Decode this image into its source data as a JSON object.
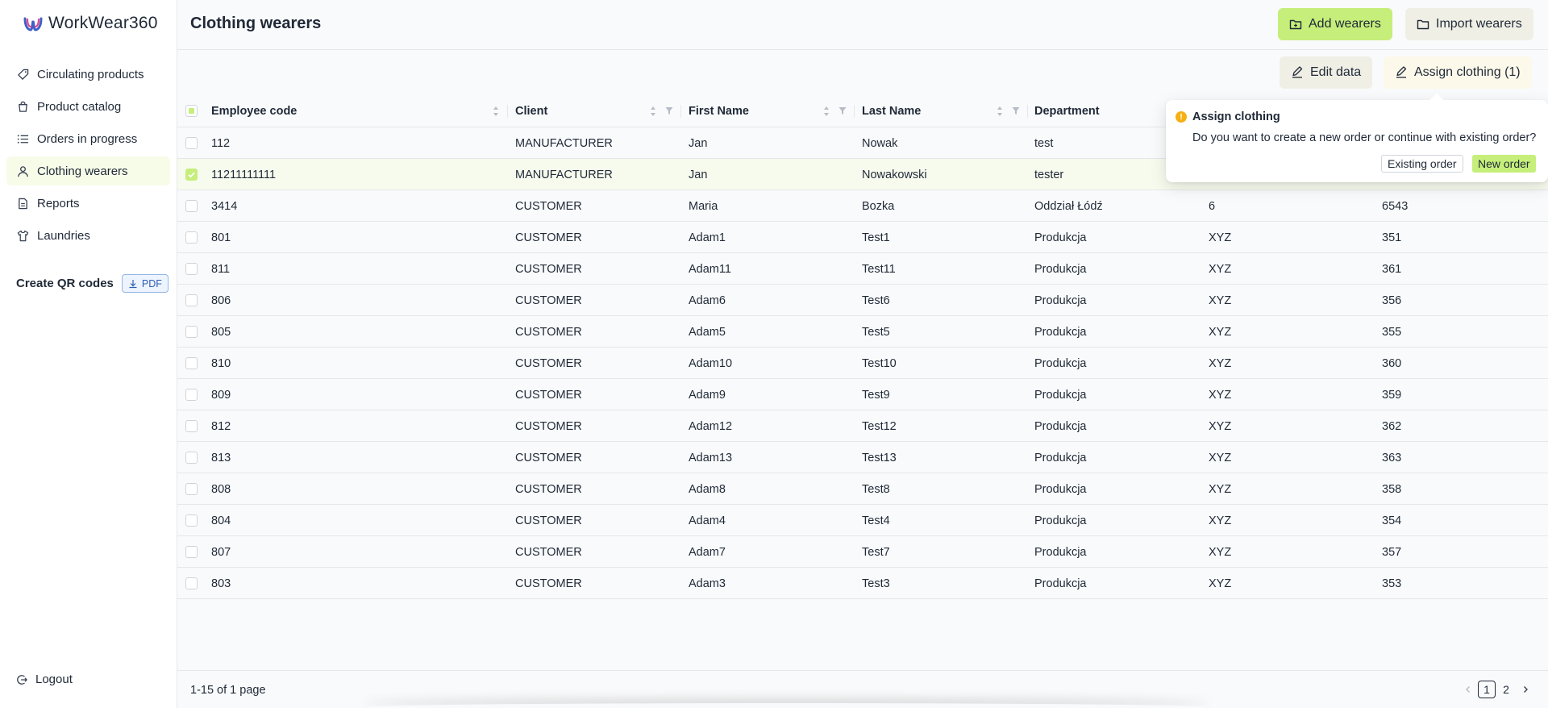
{
  "app": {
    "name": "WorkWear360"
  },
  "sidebar": {
    "items": [
      {
        "label": "Circulating products",
        "icon": "tag-icon"
      },
      {
        "label": "Product catalog",
        "icon": "shopping-bag-icon"
      },
      {
        "label": "Orders in progress",
        "icon": "list-icon"
      },
      {
        "label": "Clothing wearers",
        "icon": "user-icon",
        "active": true
      },
      {
        "label": "Reports",
        "icon": "document-icon"
      },
      {
        "label": "Laundries",
        "icon": "shirt-icon"
      }
    ],
    "qr_label": "Create QR codes",
    "pdf_label": "PDF",
    "logout_label": "Logout"
  },
  "header": {
    "title": "Clothing wearers",
    "add_label": "Add wearers",
    "import_label": "Import wearers"
  },
  "toolbar": {
    "edit_label": "Edit data",
    "assign_label": "Assign clothing (1)"
  },
  "table": {
    "columns": [
      "Employee code",
      "Client",
      "First Name",
      "Last Name",
      "Department"
    ],
    "rows": [
      {
        "code": "112",
        "client": "MANUFACTURER",
        "first": "Jan",
        "last": "Nowak",
        "dept": "test",
        "c6": "",
        "c7": "",
        "selected": false
      },
      {
        "code": "11211111111",
        "client": "MANUFACTURER",
        "first": "Jan",
        "last": "Nowakowski",
        "dept": "tester",
        "c6": "",
        "c7": "",
        "selected": true
      },
      {
        "code": "3414",
        "client": "CUSTOMER",
        "first": "Maria",
        "last": "Bozka",
        "dept": "Oddział Łódź",
        "c6": "6",
        "c7": "6543",
        "selected": false
      },
      {
        "code": "801",
        "client": "CUSTOMER",
        "first": "Adam1",
        "last": "Test1",
        "dept": "Produkcja",
        "c6": "XYZ",
        "c7": "351",
        "selected": false
      },
      {
        "code": "811",
        "client": "CUSTOMER",
        "first": "Adam11",
        "last": "Test11",
        "dept": "Produkcja",
        "c6": "XYZ",
        "c7": "361",
        "selected": false
      },
      {
        "code": "806",
        "client": "CUSTOMER",
        "first": "Adam6",
        "last": "Test6",
        "dept": "Produkcja",
        "c6": "XYZ",
        "c7": "356",
        "selected": false
      },
      {
        "code": "805",
        "client": "CUSTOMER",
        "first": "Adam5",
        "last": "Test5",
        "dept": "Produkcja",
        "c6": "XYZ",
        "c7": "355",
        "selected": false
      },
      {
        "code": "810",
        "client": "CUSTOMER",
        "first": "Adam10",
        "last": "Test10",
        "dept": "Produkcja",
        "c6": "XYZ",
        "c7": "360",
        "selected": false
      },
      {
        "code": "809",
        "client": "CUSTOMER",
        "first": "Adam9",
        "last": "Test9",
        "dept": "Produkcja",
        "c6": "XYZ",
        "c7": "359",
        "selected": false
      },
      {
        "code": "812",
        "client": "CUSTOMER",
        "first": "Adam12",
        "last": "Test12",
        "dept": "Produkcja",
        "c6": "XYZ",
        "c7": "362",
        "selected": false
      },
      {
        "code": "813",
        "client": "CUSTOMER",
        "first": "Adam13",
        "last": "Test13",
        "dept": "Produkcja",
        "c6": "XYZ",
        "c7": "363",
        "selected": false
      },
      {
        "code": "808",
        "client": "CUSTOMER",
        "first": "Adam8",
        "last": "Test8",
        "dept": "Produkcja",
        "c6": "XYZ",
        "c7": "358",
        "selected": false
      },
      {
        "code": "804",
        "client": "CUSTOMER",
        "first": "Adam4",
        "last": "Test4",
        "dept": "Produkcja",
        "c6": "XYZ",
        "c7": "354",
        "selected": false
      },
      {
        "code": "807",
        "client": "CUSTOMER",
        "first": "Adam7",
        "last": "Test7",
        "dept": "Produkcja",
        "c6": "XYZ",
        "c7": "357",
        "selected": false
      },
      {
        "code": "803",
        "client": "CUSTOMER",
        "first": "Adam3",
        "last": "Test3",
        "dept": "Produkcja",
        "c6": "XYZ",
        "c7": "353",
        "selected": false
      }
    ]
  },
  "popover": {
    "title": "Assign clothing",
    "message": "Do you want to create a new order or continue with existing order?",
    "existing_label": "Existing order",
    "new_label": "New order"
  },
  "footer": {
    "summary": "1-15 of 1 page",
    "pages": [
      "1",
      "2"
    ],
    "current_page": "1"
  },
  "colors": {
    "accent": "#c6ee7a",
    "active_nav": "#f7fce9",
    "warning": "#f5b014"
  }
}
